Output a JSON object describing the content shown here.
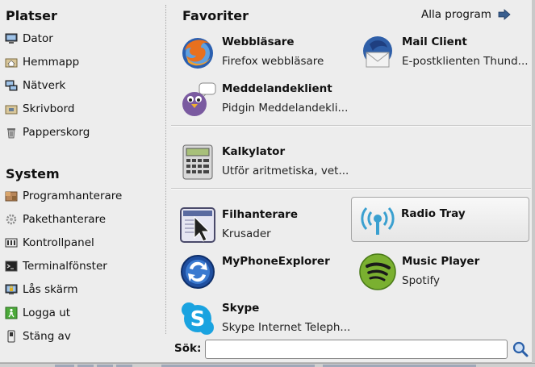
{
  "places": {
    "title": "Platser",
    "items": [
      {
        "label": "Dator",
        "icon": "computer-icon"
      },
      {
        "label": "Hemmapp",
        "icon": "home-folder-icon"
      },
      {
        "label": "Nätverk",
        "icon": "network-icon"
      },
      {
        "label": "Skrivbord",
        "icon": "desktop-icon"
      },
      {
        "label": "Papperskorg",
        "icon": "trash-icon"
      }
    ]
  },
  "system": {
    "title": "System",
    "items": [
      {
        "label": "Programhanterare",
        "icon": "package-manager-icon"
      },
      {
        "label": "Pakethanterare",
        "icon": "gear-icon"
      },
      {
        "label": "Kontrollpanel",
        "icon": "control-panel-icon"
      },
      {
        "label": "Terminalfönster",
        "icon": "terminal-icon"
      },
      {
        "label": "Lås skärm",
        "icon": "lock-screen-icon"
      },
      {
        "label": "Logga ut",
        "icon": "logout-icon"
      },
      {
        "label": "Stäng av",
        "icon": "power-icon"
      }
    ]
  },
  "favorites": {
    "title": "Favoriter",
    "all_programs": "Alla program",
    "apps": [
      {
        "name": "Webbläsare",
        "desc": "Firefox webbläsare",
        "icon": "firefox-icon"
      },
      {
        "name": "Mail Client",
        "desc": "E-postklienten Thund...",
        "icon": "thunderbird-icon"
      },
      {
        "name": "Meddelandeklient",
        "desc": "Pidgin Meddelandekli...",
        "icon": "pidgin-icon"
      },
      {
        "name": "Kalkylator",
        "desc": "Utför aritmetiska, vet...",
        "icon": "calculator-icon"
      },
      {
        "name": "Filhanterare",
        "desc": "Krusader",
        "icon": "file-manager-icon"
      },
      {
        "name": "Radio Tray",
        "desc": "",
        "icon": "radio-tray-icon"
      },
      {
        "name": "MyPhoneExplorer",
        "desc": "",
        "icon": "myphoneexplorer-icon"
      },
      {
        "name": "Music Player",
        "desc": "Spotify",
        "icon": "spotify-icon"
      },
      {
        "name": "Skype",
        "desc": "Skype Internet Teleph...",
        "icon": "skype-icon"
      }
    ]
  },
  "search": {
    "label": "Sök:",
    "value": "",
    "placeholder": ""
  },
  "colors": {
    "panel_bg": "#ededed",
    "selected_border": "#a5a5a5",
    "search_accent": "#2a5fa8"
  }
}
